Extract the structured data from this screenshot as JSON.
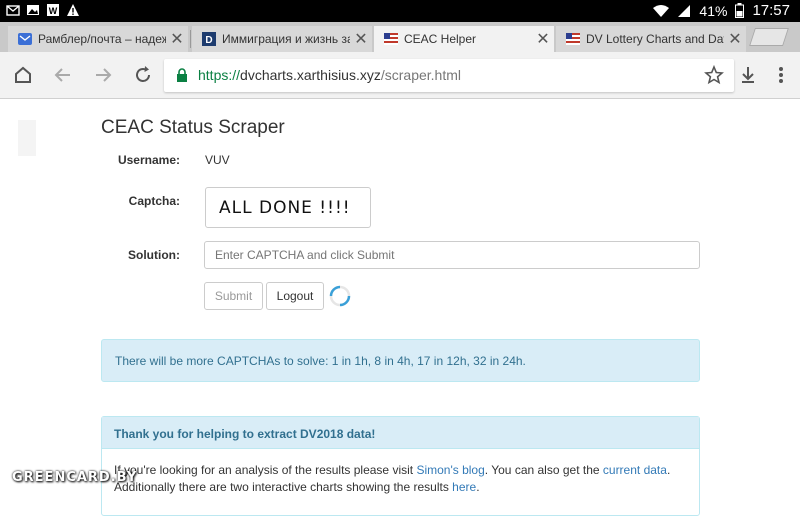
{
  "status_bar": {
    "battery_percent": "41%",
    "time": "17:57",
    "left_icons": [
      "mail-icon",
      "image-icon",
      "app-icon",
      "warning-icon"
    ],
    "right_icons": [
      "wifi-icon",
      "signal-icon",
      "battery-icon"
    ]
  },
  "tabs": [
    {
      "title": "Рамблер/почта – надежн",
      "favicon": "mail-icon",
      "active": false
    },
    {
      "title": "Иммиграция и жизнь за",
      "favicon": "d-logo-icon",
      "active": false
    },
    {
      "title": "CEAC Helper",
      "favicon": "flag-icon",
      "active": true
    },
    {
      "title": "DV Lottery Charts and Dat",
      "favicon": "flag-icon",
      "active": false
    }
  ],
  "toolbar": {
    "url_scheme": "https://",
    "url_host": "dvcharts.xarthisius.xyz",
    "url_path": "/scraper.html"
  },
  "page": {
    "title": "CEAC Status Scraper",
    "username_label": "Username:",
    "username_value": "VUV",
    "captcha_label": "Captcha:",
    "captcha_text": "ALL DONE !!!!",
    "solution_label": "Solution:",
    "solution_placeholder": "Enter CAPTCHA and click Submit",
    "submit_label": "Submit",
    "logout_label": "Logout",
    "info_text": "There will be more CAPTCHAs to solve: 1 in 1h, 8 in 4h, 17 in 12h, 32 in 24h.",
    "panel_heading": "Thank you for helping to extract DV2018 data!",
    "panel_body": {
      "text1": "If you're looking for an analysis of the results please visit ",
      "link1": "Simon's blog",
      "text2": ". You can also get the ",
      "link2": "current data",
      "text3": ".",
      "text4": "Additionally there are two interactive charts showing the results ",
      "link3": "here",
      "text5": "."
    }
  },
  "watermark": "GREENCARD.BY",
  "colors": {
    "info_bg": "#d9edf7",
    "info_text": "#31708f",
    "link": "#337ab7",
    "secure": "#0b8043"
  }
}
